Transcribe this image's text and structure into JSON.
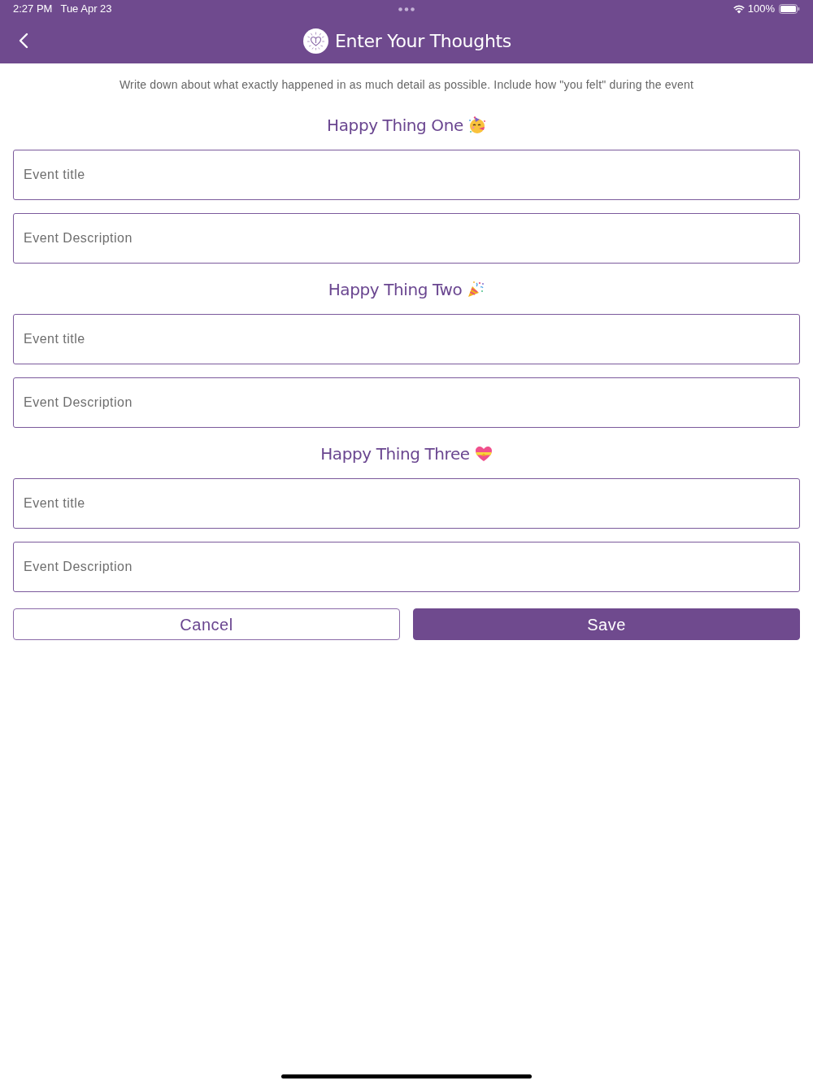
{
  "status_bar": {
    "time": "2:27 PM",
    "date": "Tue Apr 23",
    "battery": "100%"
  },
  "header": {
    "title": "Enter Your Thoughts"
  },
  "instructions": "Write down about what exactly happened in as much detail as possible. Include how \"you felt\" during the event",
  "sections": [
    {
      "heading": "Happy Thing One",
      "fields": [
        {
          "placeholder": "Event title"
        },
        {
          "placeholder": "Event Description"
        }
      ]
    },
    {
      "heading": "Happy Thing Two",
      "fields": [
        {
          "placeholder": "Event title"
        },
        {
          "placeholder": "Event Description"
        }
      ]
    },
    {
      "heading": "Happy Thing Three",
      "fields": [
        {
          "placeholder": "Event title"
        },
        {
          "placeholder": "Event Description"
        }
      ]
    }
  ],
  "buttons": [
    {
      "label": "Cancel",
      "kind": "outline"
    },
    {
      "label": "Save",
      "kind": "filled"
    }
  ]
}
